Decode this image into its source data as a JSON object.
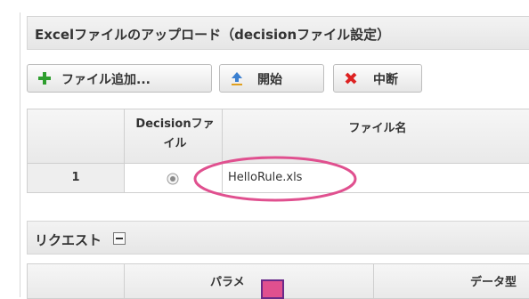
{
  "upload": {
    "title": "Excelファイルのアップロード（decisionファイル設定）",
    "buttons": {
      "add": "ファイル追加...",
      "start": "開始",
      "stop": "中断"
    },
    "table": {
      "col_decision": "Decisionファイル",
      "col_filename": "ファイル名",
      "rows": [
        {
          "num": "1",
          "filename": "HelloRule.xls"
        }
      ]
    }
  },
  "request": {
    "title": "リクエスト",
    "table": {
      "col_param": "パラメ",
      "col_datatype": "データ型"
    }
  }
}
